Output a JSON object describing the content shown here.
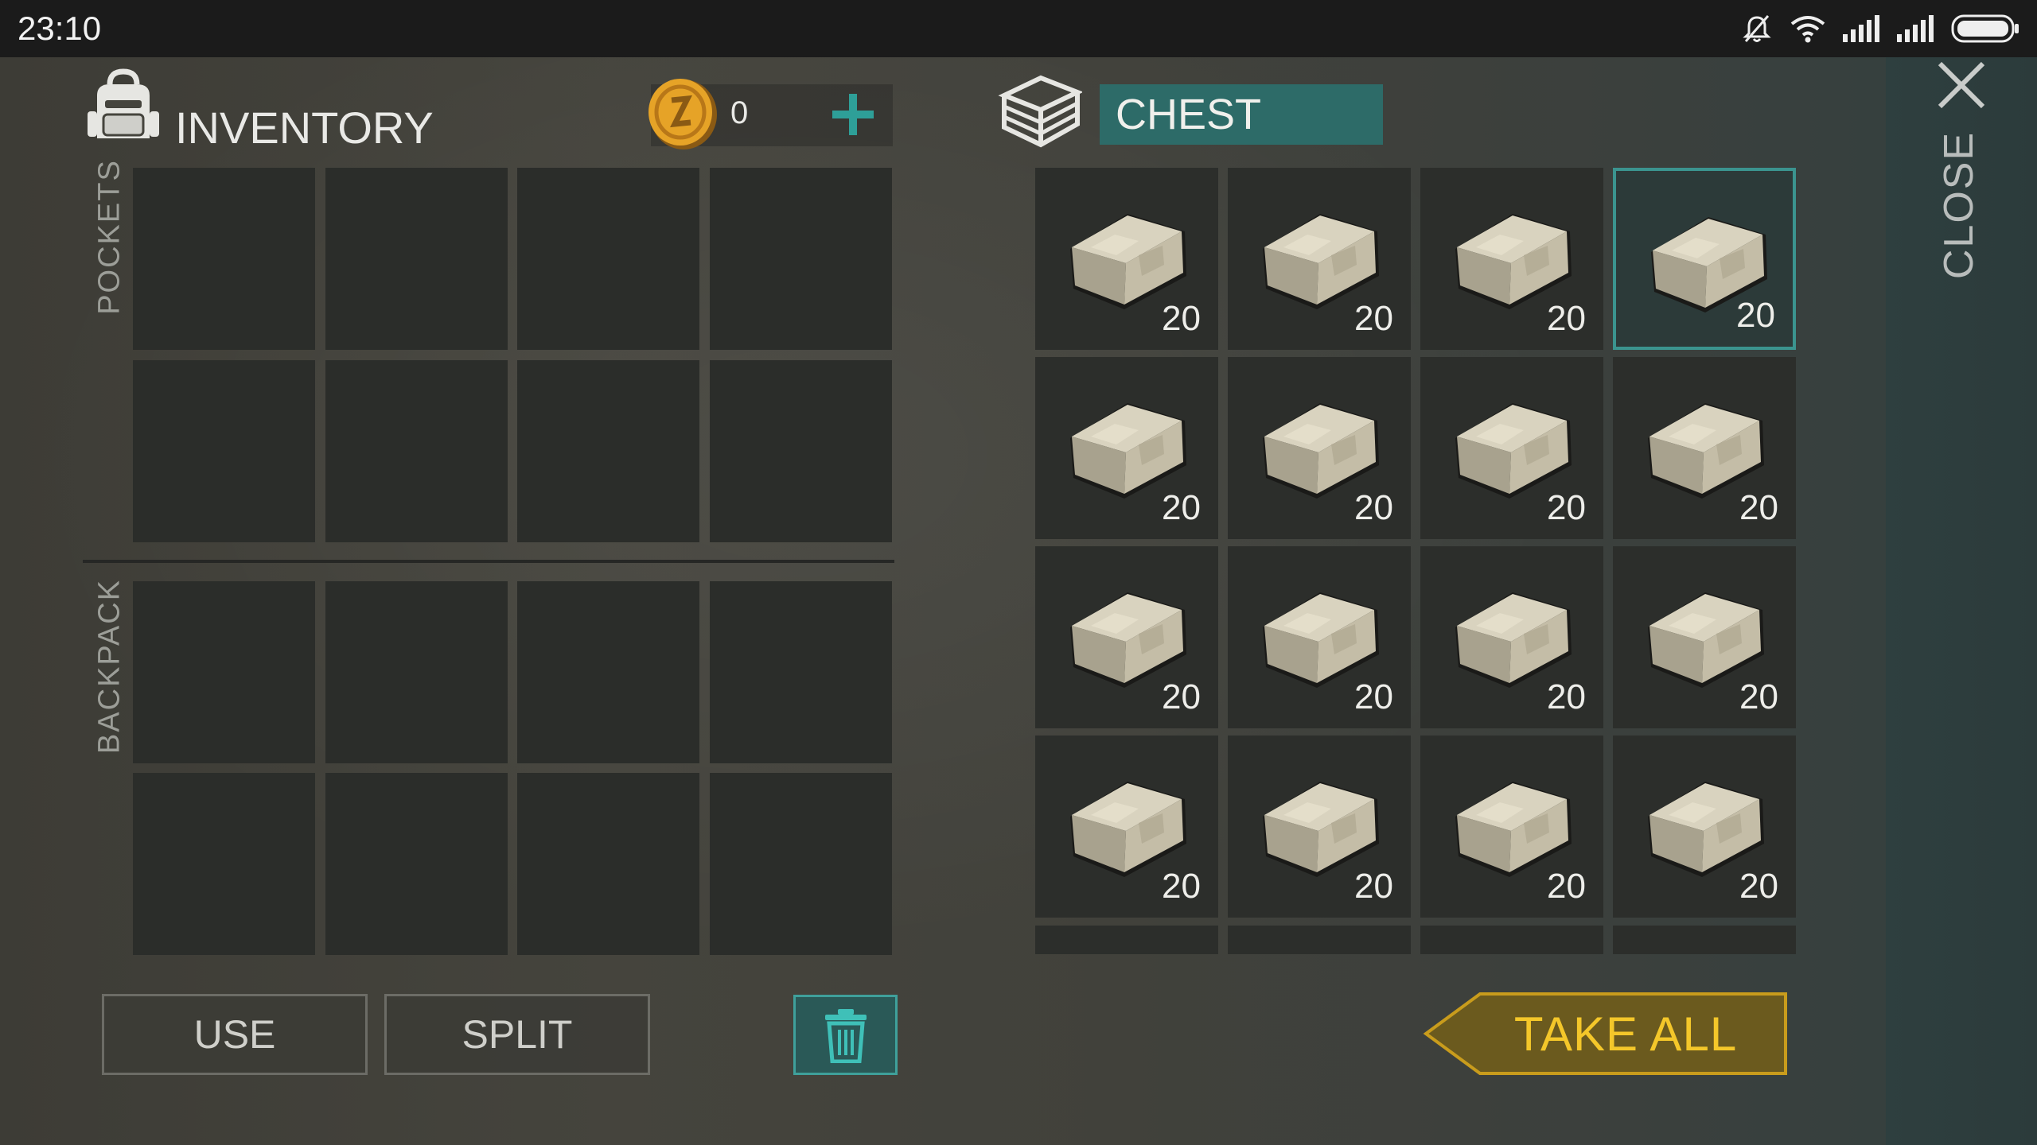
{
  "status_bar": {
    "time": "23:10",
    "icons": [
      "bell-muted-icon",
      "wifi-icon",
      "signal-icon",
      "signal-icon",
      "battery-icon"
    ]
  },
  "inventory": {
    "title": "INVENTORY",
    "coins": "0",
    "pockets_label": "POCKETS",
    "backpack_label": "BACKPACK"
  },
  "chest": {
    "title": "CHEST",
    "items": [
      {
        "name": "stone",
        "qty": "20"
      },
      {
        "name": "stone",
        "qty": "20"
      },
      {
        "name": "stone",
        "qty": "20"
      },
      {
        "name": "stone",
        "qty": "20"
      },
      {
        "name": "stone",
        "qty": "20"
      },
      {
        "name": "stone",
        "qty": "20"
      },
      {
        "name": "stone",
        "qty": "20"
      },
      {
        "name": "stone",
        "qty": "20"
      },
      {
        "name": "stone",
        "qty": "20"
      },
      {
        "name": "stone",
        "qty": "20"
      },
      {
        "name": "stone",
        "qty": "20"
      },
      {
        "name": "stone",
        "qty": "20"
      },
      {
        "name": "stone",
        "qty": "20"
      },
      {
        "name": "stone",
        "qty": "20"
      },
      {
        "name": "stone",
        "qty": "20"
      },
      {
        "name": "stone",
        "qty": "20"
      }
    ]
  },
  "buttons": {
    "use": "USE",
    "split": "SPLIT",
    "take_all": "TAKE ALL"
  },
  "close_label": "CLOSE",
  "colors": {
    "accent_teal": "#2d6b68",
    "take_all_gold": "#f4c72a",
    "take_all_bg": "#6b5a1e"
  }
}
